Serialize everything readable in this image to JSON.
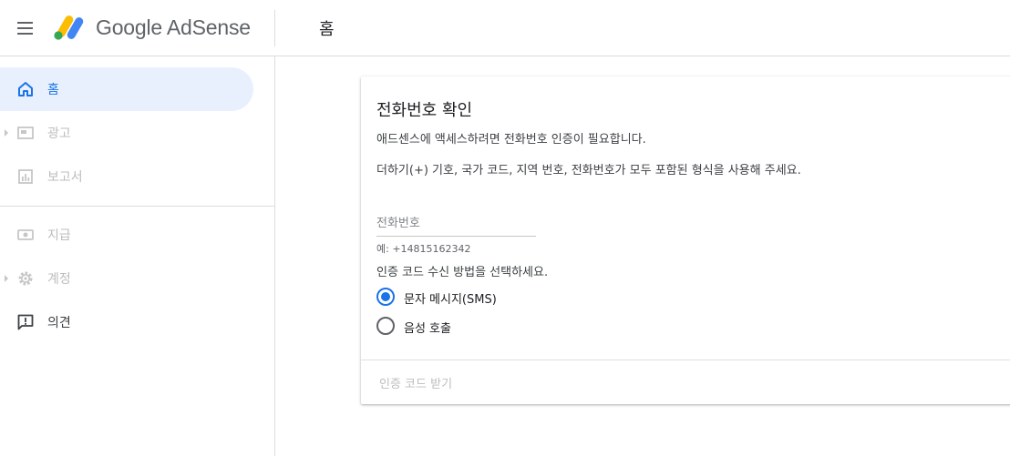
{
  "header": {
    "brand": "Google AdSense",
    "page_title": "홈"
  },
  "sidebar": {
    "items": [
      {
        "label": "홈",
        "icon": "home-icon",
        "state": "active"
      },
      {
        "label": "광고",
        "icon": "ads-icon",
        "state": "disabled"
      },
      {
        "label": "보고서",
        "icon": "reports-icon",
        "state": "disabled"
      },
      {
        "label": "지급",
        "icon": "payments-icon",
        "state": "disabled"
      },
      {
        "label": "계정",
        "icon": "gear-icon",
        "state": "disabled"
      },
      {
        "label": "의견",
        "icon": "feedback-icon",
        "state": "enabled"
      }
    ]
  },
  "verify_card": {
    "title": "전화번호 확인",
    "description": "애드센스에 액세스하려면 전화번호 인증이 필요합니다.",
    "format_note": "더하기(+) 기호, 국가 코드, 지역 번호, 전화번호가 모두 포함된 형식을 사용해 주세요.",
    "phone_placeholder": "전화번호",
    "phone_value": "",
    "phone_hint": "예: +14815162342",
    "method_label": "인증 코드 수신 방법을 선택하세요.",
    "methods": [
      {
        "label": "문자 메시지(SMS)",
        "selected": true
      },
      {
        "label": "음성 호출",
        "selected": false
      }
    ],
    "submit_label": "인증 코드 받기"
  },
  "colors": {
    "accent": "#1a73e8",
    "active_nav_bg": "#e8f0fe",
    "disabled_text": "#bdbdbd",
    "logo_yellow": "#fbbc04",
    "logo_blue": "#4285f4",
    "logo_green": "#34a853"
  }
}
